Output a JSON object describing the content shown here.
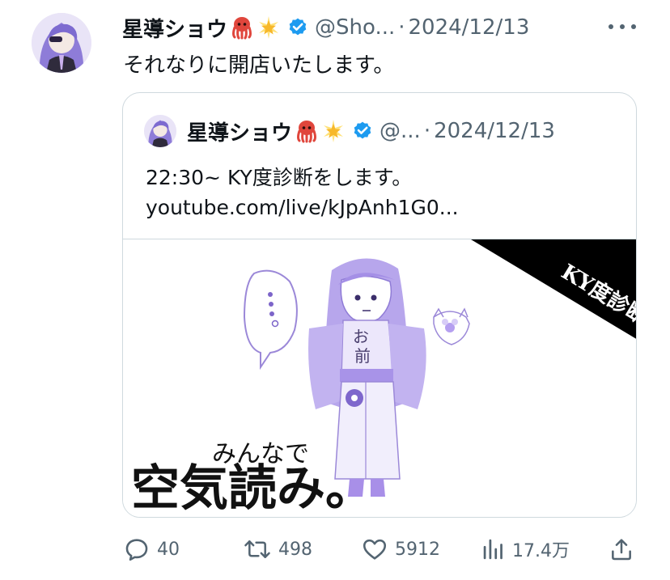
{
  "tweet": {
    "author_name": "星導ショウ",
    "emoji_1": "octopus-emoji",
    "emoji_2": "glowing-star-emoji",
    "verified_icon": "verified-badge-icon",
    "handle": "@Sho...",
    "separator": "·",
    "date": "2024/12/13",
    "text": "それなりに開店いたします。"
  },
  "quoted": {
    "author_name": "星導ショウ",
    "handle": "@...",
    "separator": "·",
    "date": "2024/12/13",
    "line1": "22:30~ KY度診断をします。",
    "line2": "youtube.com/live/kJpAnh1G0...",
    "thumbnail": {
      "banner_text": "KY度診断",
      "subtitle": "みんなで",
      "title": "空気読み。",
      "robe_text_1": "お",
      "robe_text_2": "前"
    }
  },
  "actions": {
    "replies": "40",
    "reposts": "498",
    "likes": "5912",
    "views": "17.4万"
  },
  "colors": {
    "text": "#0f1419",
    "secondary": "#536471",
    "border": "#cfd9de",
    "verified": "#1d9bf0",
    "accent_purple": "#a58ee0"
  }
}
